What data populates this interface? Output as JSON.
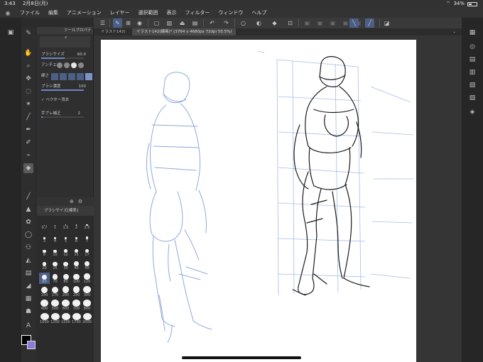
{
  "status": {
    "time": "3:43",
    "date": "2月8日(月)",
    "battery_pct": "34%",
    "battery_level": 0.34
  },
  "menu": [
    "ファイル",
    "編集",
    "アニメーション",
    "レイヤー",
    "選択範囲",
    "表示",
    "フィルター",
    "ウィンドウ",
    "ヘルプ"
  ],
  "tool_panel": {
    "header": "ツールプロパティ",
    "brush_size_label": "ブラシサイズ",
    "brush_size_value": "60.0",
    "antialias_label": "アンチエイ",
    "hardness_label": "硬さ",
    "density_label": "ブラシ濃度",
    "density_value": "100",
    "vector_label": "ベクター消去",
    "stabilization_label": "手ブレ補正",
    "stabilization_value": "2"
  },
  "brush_size_panel": {
    "title": "ブラシサイズ[標準]",
    "sizes": [
      "0.7",
      "1",
      "1.5",
      "2",
      "2.5",
      "3",
      "4",
      "5",
      "6",
      "7",
      "8",
      "10",
      "12",
      "15",
      "17",
      "20",
      "25",
      "30",
      "40",
      "50",
      "60",
      "70",
      "80",
      "100",
      "120",
      "150",
      "170",
      "200",
      "250",
      "300",
      "400",
      "500",
      "600",
      "700",
      "800",
      "1000",
      "1200",
      "1500",
      "1700",
      "2000"
    ],
    "selected": "60"
  },
  "document": {
    "tab_prev": "イラスト142(",
    "tab_active": "イラスト142(線画)* (3764 x 4680px 72dpi 50.5%)"
  },
  "icons": {
    "left_tools": [
      "layer-icon",
      "pen-icon",
      "hand-icon",
      "zoom-icon",
      "move-icon",
      "lasso-icon",
      "wand-icon",
      "line-icon",
      "pen-nib-icon",
      "ink-icon",
      "brush-icon",
      "eraser-icon",
      "dropper-icon",
      "blur-icon",
      "fill-icon",
      "gradient-icon",
      "figure-icon",
      "frame-icon",
      "text-icon"
    ],
    "right_panels": [
      "layers-icon",
      "navigator-icon",
      "properties-icon",
      "material-icon",
      "color-icon",
      "sublayer-icon"
    ]
  },
  "colors": {
    "accent": "#4a5f86",
    "main_color": "#000000",
    "sub_color": "#8d7ad6"
  }
}
